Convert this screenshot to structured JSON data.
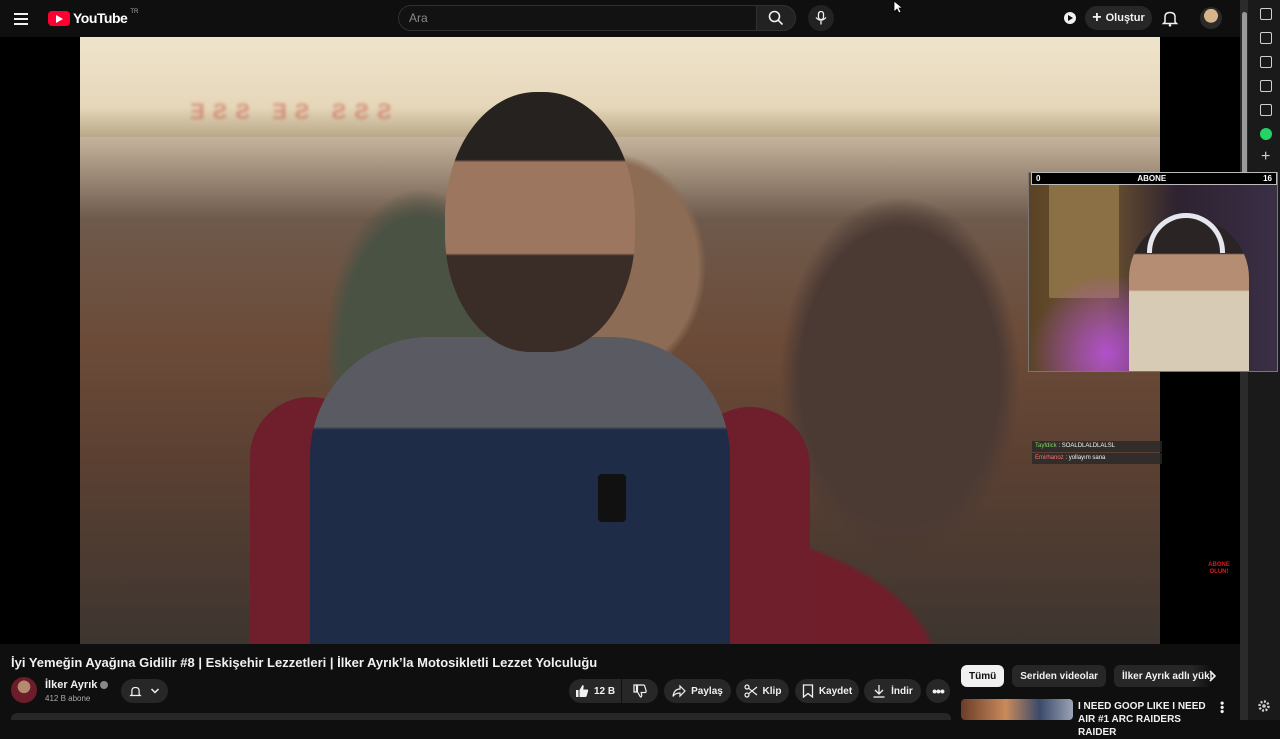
{
  "header": {
    "logo_text": "YouTube",
    "logo_country": "TR",
    "search_placeholder": "Ara",
    "create_label": "Oluştur"
  },
  "stream_overlay": {
    "sub_goal_left": "0",
    "sub_goal_label": "ABONE",
    "sub_goal_right": "16",
    "chat": [
      {
        "user": "Tayfdick",
        "message": ": SOALDLALDLALSL"
      },
      {
        "user": "Emirhanoz",
        "message": ": yollayım sana"
      }
    ],
    "logo_text": "ABONE OLUN!"
  },
  "video": {
    "title": "İyi Yemeğin Ayağına Gidilir #8 | Eskişehir Lezzetleri | İlker Ayrık’la Motosikletli Lezzet Yolculuğu",
    "channel_name": "İlker Ayrık",
    "subscribers": "412 B abone"
  },
  "actions": {
    "like_count": "12 B",
    "share_label": "Paylaş",
    "clip_label": "Klip",
    "save_label": "Kaydet",
    "download_label": "İndir"
  },
  "recommendations": {
    "chips": [
      "Tümü",
      "Seriden videolar",
      "İlker Ayrık adlı yükleyi"
    ],
    "items": [
      {
        "title": "I NEED GOOP LIKE I NEED AIR #1 ARC RAIDERS RAIDER"
      }
    ]
  },
  "colors": {
    "brand_red": "#ff0033",
    "background": "#0f0f0f",
    "chip_bg": "#272727"
  }
}
